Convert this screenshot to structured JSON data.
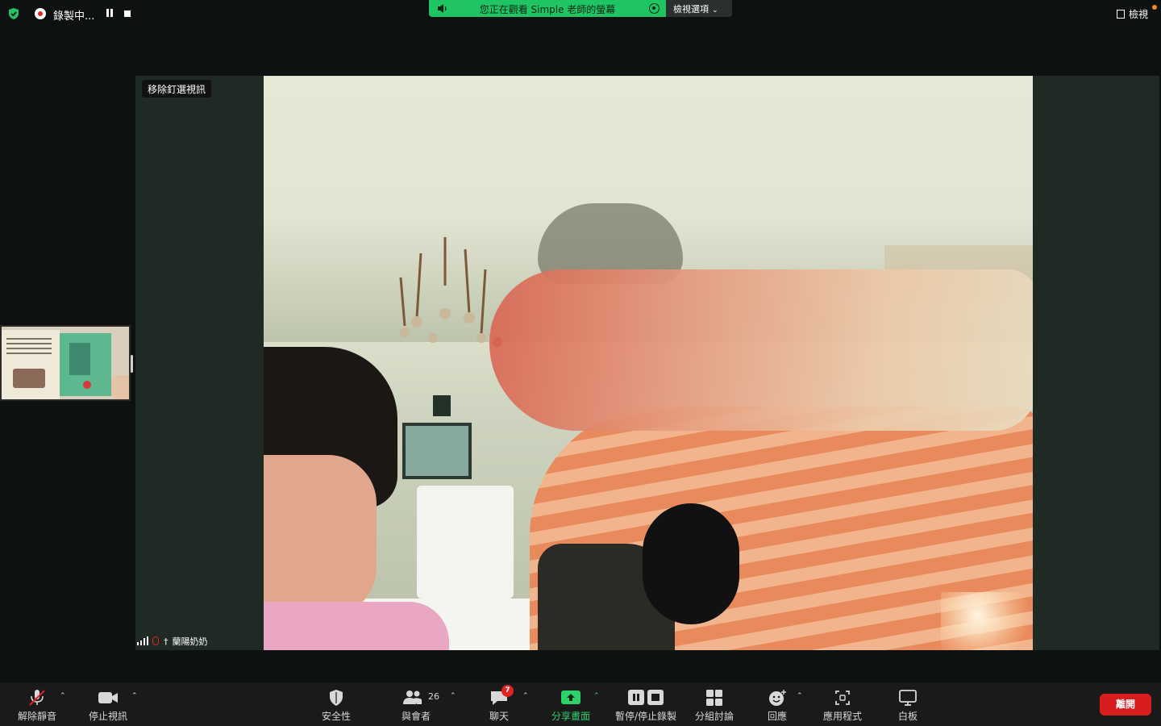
{
  "topbar": {
    "recording_label": "錄製中...",
    "share_banner_text": "您正在觀看 Simple 老師的螢幕",
    "view_options_label": "檢視選項",
    "view_button_label": "檢視"
  },
  "video": {
    "unpin_label": "移除釘選視訊",
    "participant_name": "蘭陽奶奶"
  },
  "toolbar": {
    "unmute_label": "解除靜音",
    "stop_video_label": "停止視訊",
    "security_label": "安全性",
    "participants_label": "與會者",
    "participants_count": "26",
    "chat_label": "聊天",
    "chat_badge": "7",
    "share_label": "分享畫面",
    "record_label": "暫停/停止錄製",
    "breakout_label": "分組討論",
    "reactions_label": "回應",
    "apps_label": "應用程式",
    "whiteboard_label": "白板",
    "leave_label": "離開"
  },
  "colors": {
    "share_green": "#1fc463",
    "leave_red": "#d71d1d",
    "active_green": "#2fd16b"
  }
}
